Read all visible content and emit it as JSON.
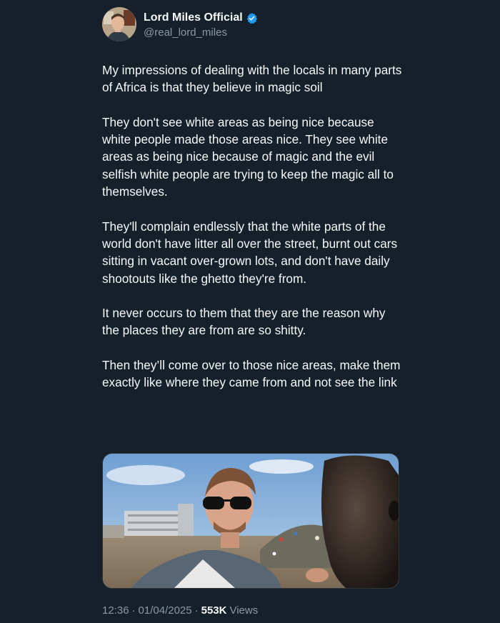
{
  "author": {
    "display_name": "Lord Miles Official",
    "handle": "@real_lord_miles",
    "verified": true,
    "verified_color": "#1d9bf0"
  },
  "tweet": {
    "paragraphs": [
      "My impressions of dealing with the locals in many parts of Africa is that they believe in magic soil",
      "They don't see white areas as being nice because white people made those areas nice. They see white areas as being nice because of magic and the evil selfish white people are trying to keep the magic all to themselves.",
      "They'll complain endlessly that the white parts of the world don't have litter all over the street, burnt out cars sitting in vacant over-grown lots, and don't have daily shootouts like the ghetto they're from.",
      "It never occurs to them that they are the reason why the places they are from are so shitty.",
      "Then they’ll come over to those nice areas, make them exactly like where they came from and not see the link"
    ]
  },
  "meta": {
    "time": "12:36",
    "separator": "·",
    "date": "01/04/2025",
    "views_count": "553K",
    "views_label": "Views"
  },
  "colors": {
    "background": "#15202b",
    "text": "#f7f9f9",
    "secondary_text": "#8b98a5"
  }
}
